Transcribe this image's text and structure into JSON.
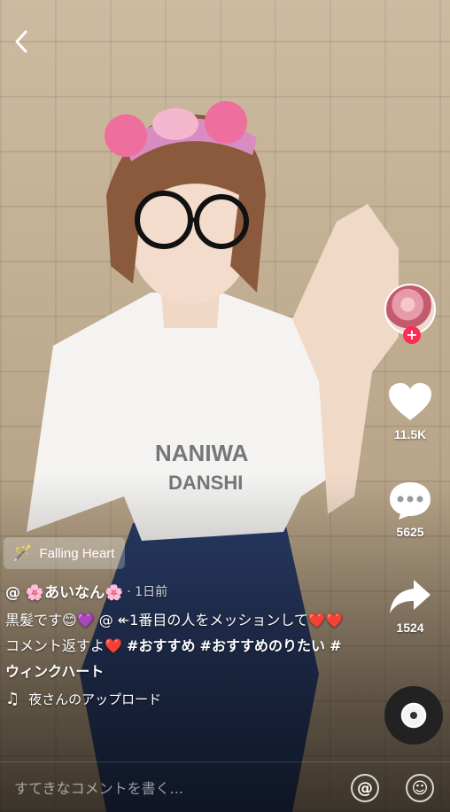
{
  "video": {
    "background": "#bca98d"
  },
  "rail": {
    "follow_plus": "+",
    "likes": "11.5K",
    "comments": "5625",
    "shares": "1524"
  },
  "sound": {
    "label": "Falling Heart"
  },
  "caption": {
    "username": "@ 🌸あいなん🌸",
    "time": "· 1日前",
    "text": "黒髪です😊💜 @ ↞1番目の人をメッションして❤️❤️コメント返すよ❤️",
    "hashtags": [
      "#おすすめ",
      "#おすすめのりたい",
      "#ウィンクハート"
    ]
  },
  "music": {
    "text": "夜さんのアップロード"
  },
  "comment_bar": {
    "placeholder": "すてきなコメントを書く...",
    "mention_symbol": "@",
    "emoji_symbol": "☺"
  }
}
